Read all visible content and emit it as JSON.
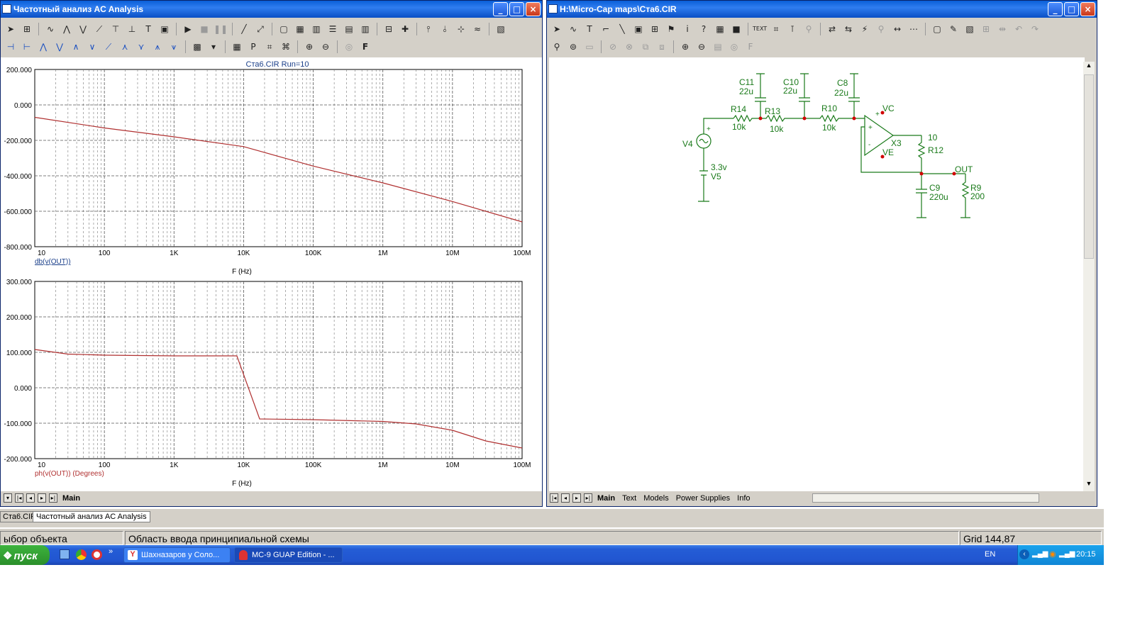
{
  "left_window": {
    "title": "Частотный анализ AC Analysis",
    "plot_title": "Ста6.CIR Run=10",
    "tabs": [
      "Main"
    ]
  },
  "right_window": {
    "title": "H:\\Micro-Cap maps\\Ста6.CIR",
    "tabs": [
      "Main",
      "Text",
      "Models",
      "Power Supplies",
      "Info"
    ]
  },
  "chart_data": [
    {
      "type": "line",
      "ylabel": "db(v(OUT))",
      "xlabel": "F (Hz)",
      "x_scale": "log",
      "grid": true,
      "x_ticks": [
        "10",
        "100",
        "1K",
        "10K",
        "100K",
        "1M",
        "10M",
        "100M"
      ],
      "y_ticks": [
        "200.000",
        "0.000",
        "-200.000",
        "-400.000",
        "-600.000",
        "-800.000"
      ],
      "ylim": [
        -800,
        200
      ],
      "xlim": [
        10,
        100000000
      ],
      "series": [
        {
          "color": "#b03030",
          "x": [
            10,
            100,
            1000,
            10000,
            100000,
            1000000,
            10000000,
            100000000
          ],
          "y": [
            -70,
            -130,
            -180,
            -235,
            -345,
            -440,
            -545,
            -660
          ]
        }
      ]
    },
    {
      "type": "line",
      "ylabel": "ph(v(OUT)) (Degrees)",
      "xlabel": "F (Hz)",
      "x_scale": "log",
      "grid": true,
      "x_ticks": [
        "10",
        "100",
        "1K",
        "10K",
        "100K",
        "1M",
        "10M",
        "100M"
      ],
      "y_ticks": [
        "300.000",
        "200.000",
        "100.000",
        "0.000",
        "-100.000",
        "-200.000"
      ],
      "ylim": [
        -200,
        300
      ],
      "xlim": [
        10,
        100000000
      ],
      "series": [
        {
          "color": "#b03030",
          "x": [
            10,
            30,
            100,
            1000,
            8000,
            17000,
            100000,
            1000000,
            3000000,
            10000000,
            30000000,
            100000000
          ],
          "y": [
            108,
            95,
            92,
            90,
            90,
            -88,
            -90,
            -95,
            -102,
            -120,
            -150,
            -170
          ]
        }
      ]
    }
  ],
  "schematic": {
    "labels": {
      "c11": "C11",
      "c11v": "22u",
      "c10": "C10",
      "c10v": "22u",
      "c8": "C8",
      "c8v": "22u",
      "r14": "R14",
      "r14v": "10k",
      "r13": "R13",
      "r13v": "10k",
      "r10": "R10",
      "r10v": "10k",
      "vc": "VC",
      "ve": "VE",
      "x3": "X3",
      "v4": "V4",
      "v5": "V5",
      "v5v": "3.3v",
      "r12": "R12",
      "r12v": "10",
      "out": "OUT",
      "c9": "C9",
      "c9v": "220u",
      "r9": "R9",
      "r9v": "200"
    }
  },
  "bottom_tabs": [
    "Ста6.CIR",
    "Частотный анализ AC Analysis"
  ],
  "status": {
    "left": "ыбор объекта",
    "middle": "Область ввода принципиальной схемы",
    "right": "Grid 144,87"
  },
  "taskbar": {
    "start": "пуск",
    "tasks": [
      "Шахназаров у Соло...",
      "MC-9 GUAP Edition - ..."
    ],
    "lang": "EN",
    "clock": "20:15"
  },
  "colors": {
    "accent": "#0a5fd8",
    "trace": "#b03030",
    "schematic": "#1a7a1a",
    "node": "#d00000"
  }
}
